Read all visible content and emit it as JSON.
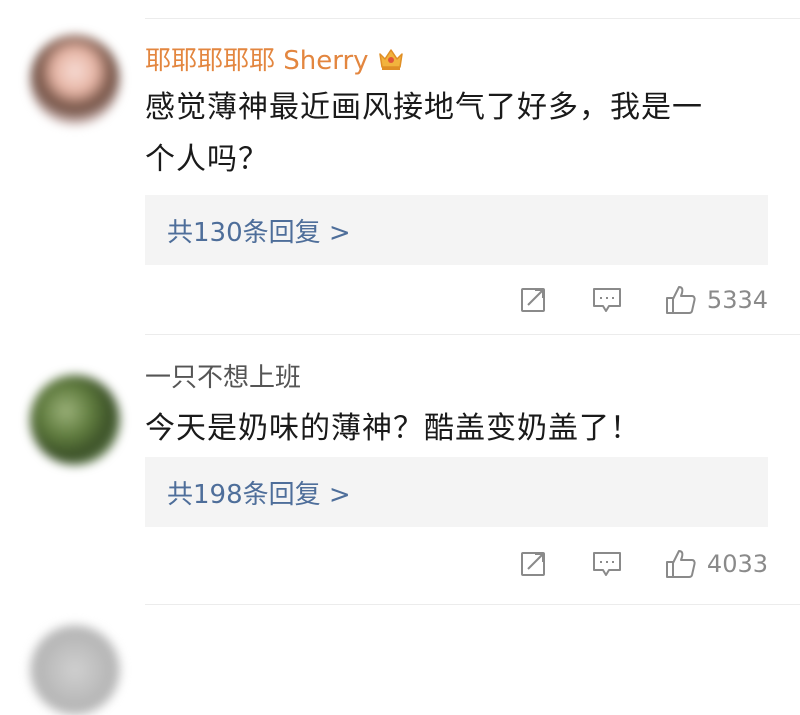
{
  "comments": [
    {
      "username": "耶耶耶耶耶 Sherry",
      "text": "感觉薄神最近画风接地气了好多，我是一个人吗？",
      "replies_label": "共130条回复 >",
      "likes": "5334"
    },
    {
      "username": "一只不想上班",
      "text": "今天是奶味的薄神？酷盖变奶盖了！",
      "replies_label": "共198条回复 >",
      "likes": "4033"
    }
  ],
  "colors": {
    "vip_name": "#e3863f",
    "name": "#555555",
    "link": "#4e6e9a",
    "text": "#1a1a1a",
    "icon": "#8a8a8a"
  },
  "icons": {
    "vip_badge": "crown-icon",
    "forward": "forward-icon",
    "comment": "comment-icon",
    "like": "thumbs-up-icon"
  }
}
